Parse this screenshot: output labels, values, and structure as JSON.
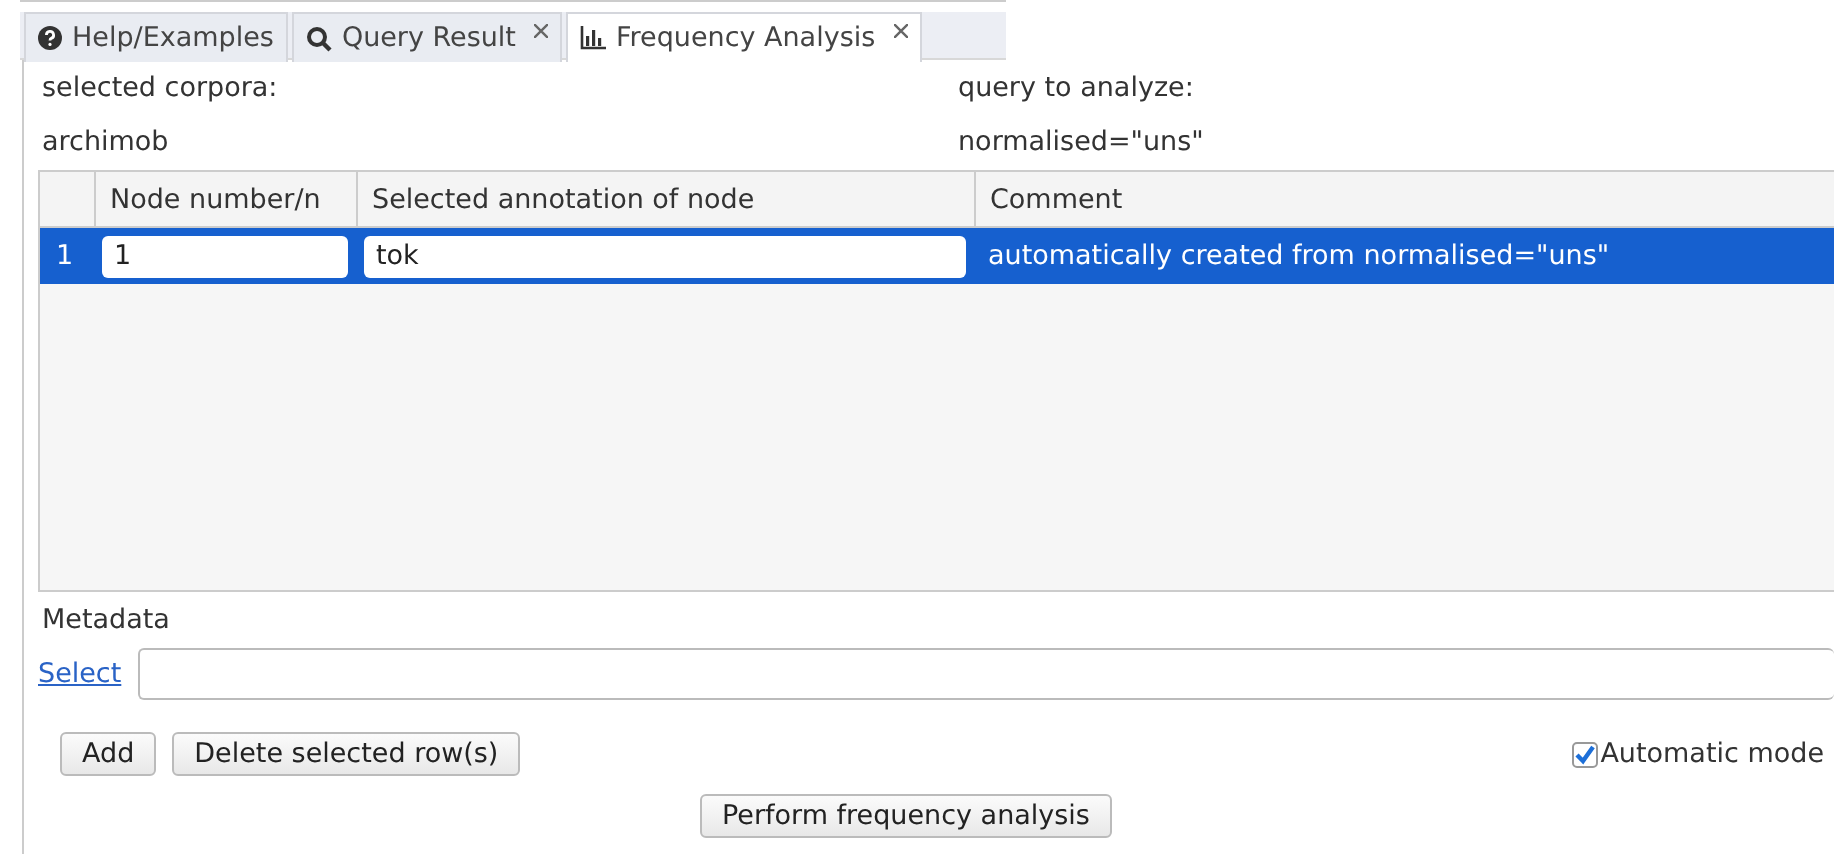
{
  "tabs": [
    {
      "label": "Help/Examples",
      "kind": "help",
      "closable": false,
      "selected": false
    },
    {
      "label": "Query Result",
      "kind": "search",
      "closable": true,
      "selected": false
    },
    {
      "label": "Frequency Analysis",
      "kind": "chart",
      "closable": true,
      "selected": true
    }
  ],
  "corpora": {
    "label": "selected corpora:",
    "value": "archimob"
  },
  "query": {
    "label": "query to analyze:",
    "value": "normalised=\"uns\""
  },
  "table": {
    "columns": [
      "Node number/n",
      "Selected annotation of node",
      "Comment"
    ],
    "rows": [
      {
        "index": "1",
        "node": "1",
        "annotation": "tok",
        "comment": "automatically created from normalised=\"uns\"",
        "selected": true
      }
    ]
  },
  "metadata": {
    "label": "Metadata",
    "link": "Select"
  },
  "buttons": {
    "add": "Add",
    "delete": "Delete selected row(s)",
    "perform": "Perform frequency analysis"
  },
  "automatic_mode": {
    "label": "Automatic mode",
    "checked": true
  }
}
